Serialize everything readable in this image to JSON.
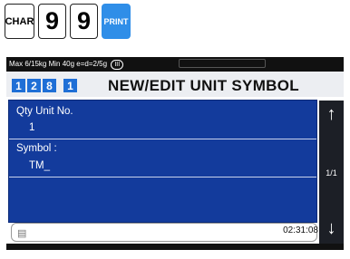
{
  "keys": {
    "char": "CHAR",
    "digit1": "9",
    "digit2": "9",
    "print": "PRINT"
  },
  "spec": {
    "text": "Max 6/15kg Min 40g e=d=2/5g",
    "class": "III"
  },
  "breadcrumb": {
    "c1": "1",
    "c2": "2",
    "c3": "8",
    "c4": "1"
  },
  "title": "NEW/EDIT UNIT SYMBOL",
  "form": {
    "qty_label": "Qty Unit No.",
    "qty_value": "1",
    "symbol_label": "Symbol :",
    "symbol_value": "TM_"
  },
  "pager": {
    "up_icon": "arrow-up-icon",
    "page": "1/1",
    "down_icon": "arrow-down-icon"
  },
  "input": {
    "icon": "keyboard-icon"
  },
  "clock": "02:31:08",
  "colors": {
    "panel": "#133b9c",
    "accent": "#1f6fd6",
    "print_key": "#2f8ee8",
    "sidebar": "#1c1f26"
  }
}
